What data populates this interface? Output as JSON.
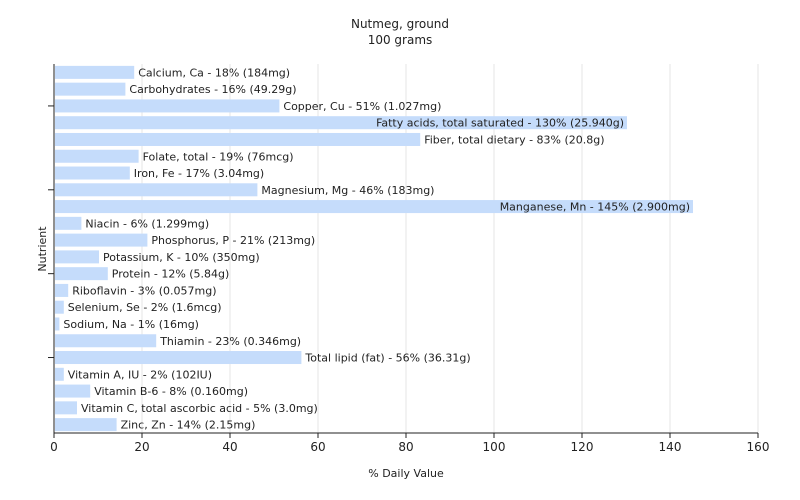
{
  "chart_data": {
    "type": "bar",
    "orientation": "horizontal",
    "title": "Nutmeg, ground",
    "subtitle": "100 grams",
    "xlabel": "% Daily Value",
    "ylabel": "Nutrient",
    "xlim": [
      0,
      160
    ],
    "xticks": [
      0,
      20,
      40,
      60,
      80,
      100,
      120,
      140,
      160
    ],
    "grid": true,
    "bar_color": "#c5dcfb",
    "grid_color": "#e6e6e6",
    "categories": [
      "Calcium, Ca",
      "Carbohydrates",
      "Copper, Cu",
      "Fatty acids, total saturated",
      "Fiber, total dietary",
      "Folate, total",
      "Iron, Fe",
      "Magnesium, Mg",
      "Manganese, Mn",
      "Niacin",
      "Phosphorus, P",
      "Potassium, K",
      "Protein",
      "Riboflavin",
      "Selenium, Se",
      "Sodium, Na",
      "Thiamin",
      "Total lipid (fat)",
      "Vitamin A, IU",
      "Vitamin B-6",
      "Vitamin C, total ascorbic acid",
      "Zinc, Zn"
    ],
    "values": [
      18,
      16,
      51,
      130,
      83,
      19,
      17,
      46,
      145,
      6,
      21,
      10,
      12,
      3,
      2,
      1,
      23,
      56,
      2,
      8,
      5,
      14
    ],
    "labels": [
      "Calcium, Ca - 18% (184mg)",
      "Carbohydrates - 16% (49.29g)",
      "Copper, Cu - 51% (1.027mg)",
      "Fatty acids, total saturated - 130% (25.940g)",
      "Fiber, total dietary - 83% (20.8g)",
      "Folate, total - 19% (76mcg)",
      "Iron, Fe - 17% (3.04mg)",
      "Magnesium, Mg - 46% (183mg)",
      "Manganese, Mn - 145% (2.900mg)",
      "Niacin - 6% (1.299mg)",
      "Phosphorus, P - 21% (213mg)",
      "Potassium, K - 10% (350mg)",
      "Protein - 12% (5.84g)",
      "Riboflavin - 3% (0.057mg)",
      "Selenium, Se - 2% (1.6mcg)",
      "Sodium, Na - 1% (16mg)",
      "Thiamin - 23% (0.346mg)",
      "Total lipid (fat) - 56% (36.31g)",
      "Vitamin A, IU - 2% (102IU)",
      "Vitamin B-6 - 8% (0.160mg)",
      "Vitamin C, total ascorbic acid - 5% (3.0mg)",
      "Zinc, Zn - 14% (2.15mg)"
    ]
  }
}
